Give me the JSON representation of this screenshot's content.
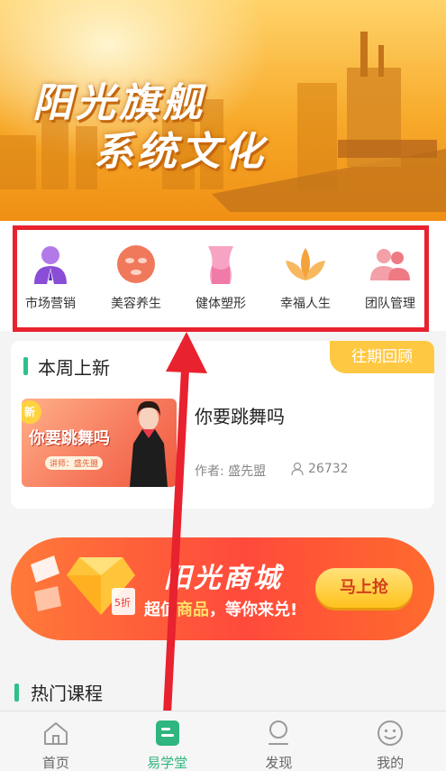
{
  "banner": {
    "title_line1": "阳光旗舰",
    "title_line2": "系统文化"
  },
  "categories": [
    {
      "label": "市场营销",
      "icon": "businessman-icon",
      "color": "#8a4dd6"
    },
    {
      "label": "美容养生",
      "icon": "face-mask-icon",
      "color": "#f0795c"
    },
    {
      "label": "健体塑形",
      "icon": "body-shape-icon",
      "color": "#f07aa8"
    },
    {
      "label": "幸福人生",
      "icon": "lotus-icon",
      "color": "#f4a23a"
    },
    {
      "label": "团队管理",
      "icon": "team-icon",
      "color": "#f07a84"
    }
  ],
  "weekly": {
    "section_title": "本周上新",
    "past_button": "往期回顾",
    "course": {
      "thumb_tag": "新",
      "thumb_title": "你要跳舞吗",
      "thumb_lecturer": "讲师：盛先盟",
      "name": "你要跳舞吗",
      "author": "作者: 盛先盟",
      "views": "26732"
    }
  },
  "promo": {
    "title": "阳光商城",
    "subtitle_a": "超值",
    "subtitle_hl": "商品",
    "subtitle_b": "，等你来兑!",
    "button": "马上抢",
    "coupon_text": "5折"
  },
  "hot": {
    "section_title": "热门课程"
  },
  "tabbar": [
    {
      "label": "首页",
      "icon": "home-icon",
      "active": false
    },
    {
      "label": "易学堂",
      "icon": "course-icon",
      "active": true
    },
    {
      "label": "发现",
      "icon": "discover-icon",
      "active": false
    },
    {
      "label": "我的",
      "icon": "profile-icon",
      "active": false
    }
  ],
  "colors": {
    "accent": "#2fb57e",
    "highlight_box": "#e8222e",
    "past_button": "#ffc842"
  }
}
